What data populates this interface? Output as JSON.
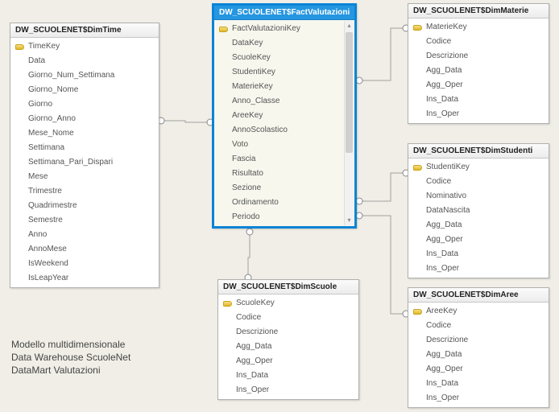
{
  "caption": {
    "line1": "Modello multidimensionale",
    "line2": "Data Warehouse ScuoleNet",
    "line3": "DataMart Valutazioni"
  },
  "tables": {
    "dimTime": {
      "title": "DW_SCUOLENET$DimTime",
      "columns": [
        {
          "name": "TimeKey",
          "key": true
        },
        {
          "name": "Data"
        },
        {
          "name": "Giorno_Num_Settimana"
        },
        {
          "name": "Giorno_Nome"
        },
        {
          "name": "Giorno"
        },
        {
          "name": "Giorno_Anno"
        },
        {
          "name": "Mese_Nome"
        },
        {
          "name": "Settimana"
        },
        {
          "name": "Settimana_Pari_Dispari"
        },
        {
          "name": "Mese"
        },
        {
          "name": "Trimestre"
        },
        {
          "name": "Quadrimestre"
        },
        {
          "name": "Semestre"
        },
        {
          "name": "Anno"
        },
        {
          "name": "AnnoMese"
        },
        {
          "name": "IsWeekend"
        },
        {
          "name": "IsLeapYear"
        }
      ]
    },
    "factValutazioni": {
      "title": "DW_SCUOLENET$FactValutazioni",
      "columns": [
        {
          "name": "FactValutazioniKey",
          "key": true
        },
        {
          "name": "DataKey"
        },
        {
          "name": "ScuoleKey"
        },
        {
          "name": "StudentiKey"
        },
        {
          "name": "MaterieKey"
        },
        {
          "name": "Anno_Classe"
        },
        {
          "name": "AreeKey"
        },
        {
          "name": "AnnoScolastico"
        },
        {
          "name": "Voto"
        },
        {
          "name": "Fascia"
        },
        {
          "name": "Risultato"
        },
        {
          "name": "Sezione"
        },
        {
          "name": "Ordinamento"
        },
        {
          "name": "Periodo"
        }
      ]
    },
    "dimMaterie": {
      "title": "DW_SCUOLENET$DimMaterie",
      "columns": [
        {
          "name": "MaterieKey",
          "key": true
        },
        {
          "name": "Codice"
        },
        {
          "name": "Descrizione"
        },
        {
          "name": "Agg_Data"
        },
        {
          "name": "Agg_Oper"
        },
        {
          "name": "Ins_Data"
        },
        {
          "name": "Ins_Oper"
        }
      ]
    },
    "dimStudenti": {
      "title": "DW_SCUOLENET$DimStudenti",
      "columns": [
        {
          "name": "StudentiKey",
          "key": true
        },
        {
          "name": "Codice"
        },
        {
          "name": "Nominativo"
        },
        {
          "name": "DataNascita"
        },
        {
          "name": "Agg_Data"
        },
        {
          "name": "Agg_Oper"
        },
        {
          "name": "Ins_Data"
        },
        {
          "name": "Ins_Oper"
        }
      ]
    },
    "dimScuole": {
      "title": "DW_SCUOLENET$DimScuole",
      "columns": [
        {
          "name": "ScuoleKey",
          "key": true
        },
        {
          "name": "Codice"
        },
        {
          "name": "Descrizione"
        },
        {
          "name": "Agg_Data"
        },
        {
          "name": "Agg_Oper"
        },
        {
          "name": "Ins_Data"
        },
        {
          "name": "Ins_Oper"
        }
      ]
    },
    "dimAree": {
      "title": "DW_SCUOLENET$DimAree",
      "columns": [
        {
          "name": "AreeKey",
          "key": true
        },
        {
          "name": "Codice"
        },
        {
          "name": "Descrizione"
        },
        {
          "name": "Agg_Data"
        },
        {
          "name": "Agg_Oper"
        },
        {
          "name": "Ins_Data"
        },
        {
          "name": "Ins_Oper"
        }
      ]
    }
  }
}
